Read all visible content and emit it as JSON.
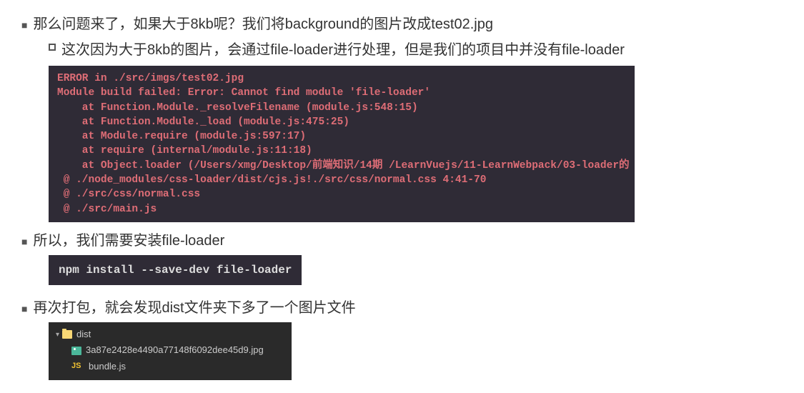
{
  "bullets": {
    "b1": "那么问题来了，如果大于8kb呢？我们将background的图片改成test02.jpg",
    "b1_sub": "这次因为大于8kb的图片，会通过file-loader进行处理，但是我们的项目中并没有file-loader",
    "b2": "所以，我们需要安装file-loader",
    "b3": "再次打包，就会发现dist文件夹下多了一个图片文件"
  },
  "error_block": {
    "l1": "ERROR in ./src/imgs/test02.jpg",
    "l2": "Module build failed: Error: Cannot find module 'file-loader'",
    "l3": "    at Function.Module._resolveFilename (module.js:548:15)",
    "l4": "    at Function.Module._load (module.js:475:25)",
    "l5": "    at Module.require (module.js:597:17)",
    "l6": "    at require (internal/module.js:11:18)",
    "l7": "    at Object.loader (/Users/xmg/Desktop/前端知识/14期 /LearnVuejs/11-LearnWebpack/03-loader的",
    "l8": " @ ./node_modules/css-loader/dist/cjs.js!./src/css/normal.css 4:41-70",
    "l9": " @ ./src/css/normal.css",
    "l10": " @ ./src/main.js"
  },
  "cmd": "npm install --save-dev file-loader",
  "tree": {
    "folder": "dist",
    "file1": "3a87e2428e4490a77148f6092dee45d9.jpg",
    "file2": "bundle.js",
    "js_label": "JS"
  }
}
